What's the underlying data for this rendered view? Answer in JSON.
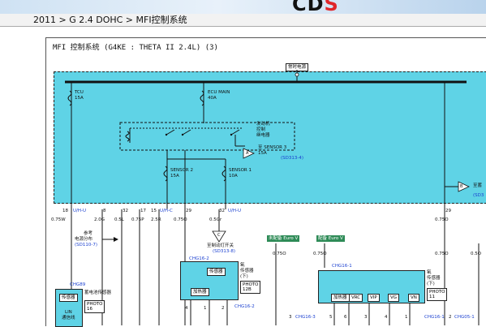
{
  "brand": {
    "logo_main": "CD",
    "logo_accent": "S"
  },
  "breadcrumb": {
    "year": "2011",
    "sep1": " > ",
    "engine": "G 2.4 DOHC",
    "sep2": " > ",
    "system": "MFI控制系统"
  },
  "diagram": {
    "title": "MFI 控制系统 (G4KE : THETA II 2.4L) (3)",
    "hot_label": "常时电源",
    "fuses": [
      {
        "name": "TCU",
        "rating": "15A"
      },
      {
        "name": "ECU MAIN",
        "rating": "40A"
      },
      {
        "name": "SENSOR 2",
        "rating": "15A"
      },
      {
        "name": "SENSOR 1",
        "rating": "10A"
      }
    ],
    "relay": {
      "line1": "发动机",
      "line2": "控制",
      "line3": "继电器"
    },
    "sensor3": {
      "label": "至 SENSOR 3",
      "rating": "15A",
      "ref": "(SD313-4)"
    },
    "connector_a": "A",
    "connector_b": "B",
    "connector_c": "C",
    "right_edge_label": "至蓄",
    "right_edge_ref": "(SD3",
    "pins": [
      {
        "pin": "18",
        "conn": "U/H-U",
        "wire": "0.75W"
      },
      {
        "pin": "8",
        "conn": "",
        "wire": "2.0G"
      },
      {
        "pin": "32",
        "conn": "",
        "wire": "0.5L"
      },
      {
        "pin": "17",
        "conn": "",
        "wire": "0.75P"
      },
      {
        "pin": "15",
        "conn": "U/H-C",
        "wire": "2.5R"
      },
      {
        "pin": "29",
        "conn": "",
        "wire": "0.75O"
      },
      {
        "pin": "32",
        "conn": "U/H-U",
        "wire": "0.5Gr"
      },
      {
        "pin": "29",
        "conn": "",
        "wire": "0.75O"
      }
    ],
    "ref_note": {
      "line1": "参考",
      "line2": "电源分布",
      "ref": "(SD110-7)"
    },
    "brake_switch": {
      "label": "至制动灯开关",
      "ref": "(SD313-8)"
    },
    "chips": [
      "未配备",
      "Euro V",
      "配备",
      "Euro V"
    ],
    "chg_labels": [
      "CHG16-2",
      "CHG16-1",
      "CHG89",
      "CHG16-2",
      "CHG16-3",
      "CHG16-1",
      "CHG05-1"
    ],
    "o2_sensor_down": {
      "l1": "氧",
      "l2": "传感器",
      "l3": "(下)",
      "photo": "PHOTO",
      "photo_no": "12B",
      "heater": "加热器",
      "sensor": "传感器"
    },
    "o2_sensor_up": {
      "l1": "氧",
      "l2": "传感器",
      "l3": "(下)",
      "photo": "PHOTO",
      "photo_no": "11"
    },
    "o2_box_labels": [
      "加热器",
      "VRC",
      "VIP",
      "VG",
      "VN"
    ],
    "battery_sensor": {
      "sensor": "传感器",
      "label": "蓄电池传感器",
      "photo": "PHOTO",
      "photo_no": "16",
      "lin": "LIN",
      "lin2": "通信线"
    },
    "wire_labels": [
      "0.75O",
      "0.75O",
      "0.75O",
      "0.5O"
    ],
    "pin_numbers_bottom": [
      "4",
      "1",
      "2",
      "3",
      "5",
      "6",
      "3",
      "4",
      "1",
      "2"
    ]
  }
}
